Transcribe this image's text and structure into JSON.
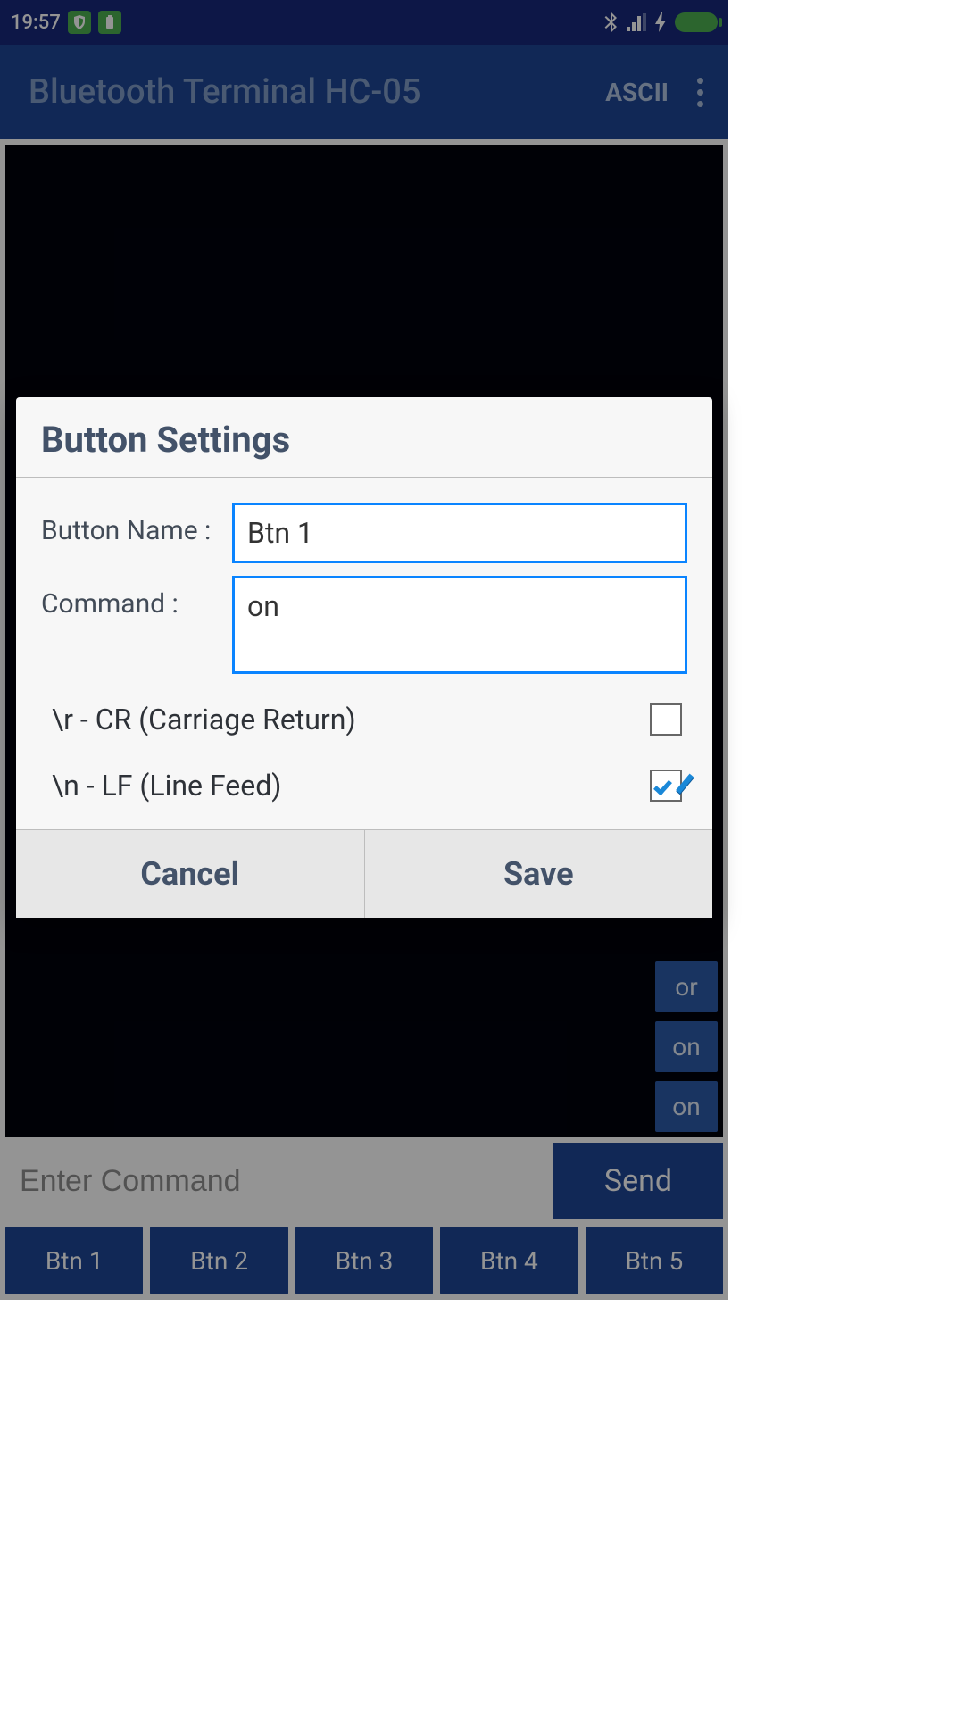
{
  "status": {
    "time": "19:57"
  },
  "toolbar": {
    "title": "Bluetooth Terminal HC-05",
    "mode": "ASCII"
  },
  "history": {
    "items": [
      "or",
      "on",
      "on"
    ]
  },
  "command": {
    "placeholder": "Enter Command",
    "send_label": "Send"
  },
  "buttons": {
    "items": [
      "Btn 1",
      "Btn 2",
      "Btn 3",
      "Btn 4",
      "Btn 5"
    ]
  },
  "dialog": {
    "title": "Button Settings",
    "name_label": "Button Name :",
    "name_value": "Btn 1",
    "command_label": "Command      :",
    "command_value": "on",
    "cr_label": "\\r - CR (Carriage Return)",
    "cr_checked": false,
    "lf_label": "\\n - LF (Line Feed)",
    "lf_checked": true,
    "cancel": "Cancel",
    "save": "Save"
  }
}
